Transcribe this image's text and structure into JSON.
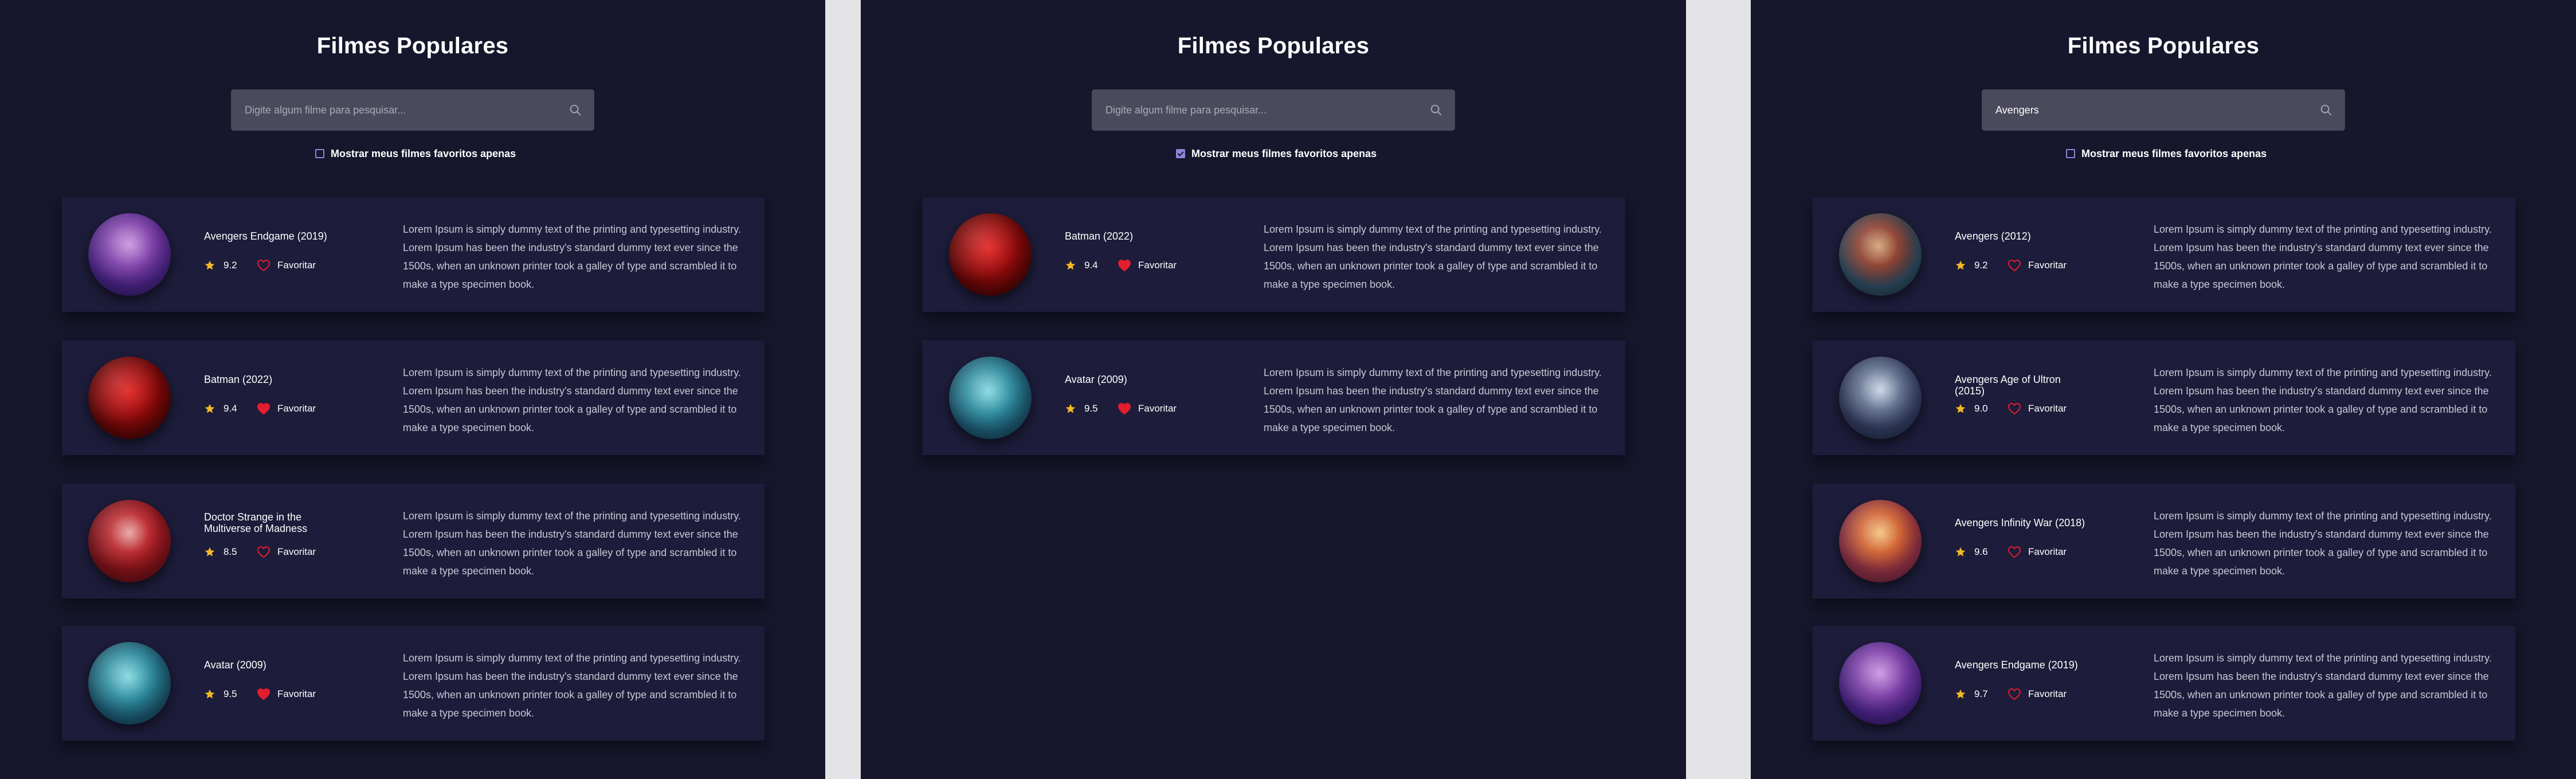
{
  "colors": {
    "background": "#16162c",
    "card": "#1d1c3a",
    "search": "#4a4a5c",
    "star": "#f2b826",
    "heart": "#e21d2e",
    "accent": "#8b86d8"
  },
  "icons": {
    "search": "magnifier-icon",
    "rating": "star-icon",
    "favorite_filled": "heart-filled-icon",
    "favorite_outline": "heart-outline-icon"
  },
  "screens": [
    {
      "title": "Filmes Populares",
      "search": {
        "value": "",
        "placeholder": "Digite algum filme para pesquisar..."
      },
      "filter": {
        "label": "Mostrar meus filmes favoritos apenas",
        "checked": false
      },
      "movies": [
        {
          "title": "Avengers Endgame (2019)",
          "rating": "9.2",
          "favorite_label": "Favoritar",
          "favorited": false,
          "description": "Lorem Ipsum is simply dummy text of the printing and typesetting industry. Lorem Ipsum has been the industry's standard dummy text ever since the 1500s, when an unknown printer took a galley of type and scrambled it to make a type specimen book."
        },
        {
          "title": "Batman (2022)",
          "rating": "9.4",
          "favorite_label": "Favoritar",
          "favorited": true,
          "description": "Lorem Ipsum is simply dummy text of the printing and typesetting industry. Lorem Ipsum has been the industry's standard dummy text ever since the 1500s, when an unknown printer took a galley of type and scrambled it to make a type specimen book."
        },
        {
          "title": "Doctor Strange in the Multiverse of Madness",
          "rating": "8.5",
          "favorite_label": "Favoritar",
          "favorited": false,
          "description": "Lorem Ipsum is simply dummy text of the printing and typesetting industry. Lorem Ipsum has been the industry's standard dummy text ever since the 1500s, when an unknown printer took a galley of type and scrambled it to make a type specimen book."
        },
        {
          "title": "Avatar (2009)",
          "rating": "9.5",
          "favorite_label": "Favoritar",
          "favorited": true,
          "description": "Lorem Ipsum is simply dummy text of the printing and typesetting industry. Lorem Ipsum has been the industry's standard dummy text ever since the 1500s, when an unknown printer took a galley of type and scrambled it to make a type specimen book."
        }
      ]
    },
    {
      "title": "Filmes Populares",
      "search": {
        "value": "",
        "placeholder": "Digite algum filme para pesquisar..."
      },
      "filter": {
        "label": "Mostrar meus filmes favoritos apenas",
        "checked": true
      },
      "movies": [
        {
          "title": "Batman (2022)",
          "rating": "9.4",
          "favorite_label": "Favoritar",
          "favorited": true,
          "description": "Lorem Ipsum is simply dummy text of the printing and typesetting industry. Lorem Ipsum has been the industry's standard dummy text ever since the 1500s, when an unknown printer took a galley of type and scrambled it to make a type specimen book."
        },
        {
          "title": "Avatar (2009)",
          "rating": "9.5",
          "favorite_label": "Favoritar",
          "favorited": true,
          "description": "Lorem Ipsum is simply dummy text of the printing and typesetting industry. Lorem Ipsum has been the industry's standard dummy text ever since the 1500s, when an unknown printer took a galley of type and scrambled it to make a type specimen book."
        }
      ]
    },
    {
      "title": "Filmes Populares",
      "search": {
        "value": "Avengers",
        "placeholder": "Digite algum filme para pesquisar..."
      },
      "filter": {
        "label": "Mostrar meus filmes favoritos apenas",
        "checked": false
      },
      "movies": [
        {
          "title": "Avengers (2012)",
          "rating": "9.2",
          "favorite_label": "Favoritar",
          "favorited": false,
          "description": "Lorem Ipsum is simply dummy text of the printing and typesetting industry. Lorem Ipsum has been the industry's standard dummy text ever since the 1500s, when an unknown printer took a galley of type and scrambled it to make a type specimen book."
        },
        {
          "title": "Avengers Age of Ultron (2015)",
          "rating": "9.0",
          "favorite_label": "Favoritar",
          "favorited": false,
          "description": "Lorem Ipsum is simply dummy text of the printing and typesetting industry. Lorem Ipsum has been the industry's standard dummy text ever since the 1500s, when an unknown printer took a galley of type and scrambled it to make a type specimen book."
        },
        {
          "title": "Avengers Infinity War (2018)",
          "rating": "9.6",
          "favorite_label": "Favoritar",
          "favorited": false,
          "description": "Lorem Ipsum is simply dummy text of the printing and typesetting industry. Lorem Ipsum has been the industry's standard dummy text ever since the 1500s, when an unknown printer took a galley of type and scrambled it to make a type specimen book."
        },
        {
          "title": "Avengers Endgame (2019)",
          "rating": "9.7",
          "favorite_label": "Favoritar",
          "favorited": false,
          "description": "Lorem Ipsum is simply dummy text of the printing and typesetting industry. Lorem Ipsum has been the industry's standard dummy text ever since the 1500s, when an unknown printer took a galley of type and scrambled it to make a type specimen book."
        }
      ]
    }
  ]
}
